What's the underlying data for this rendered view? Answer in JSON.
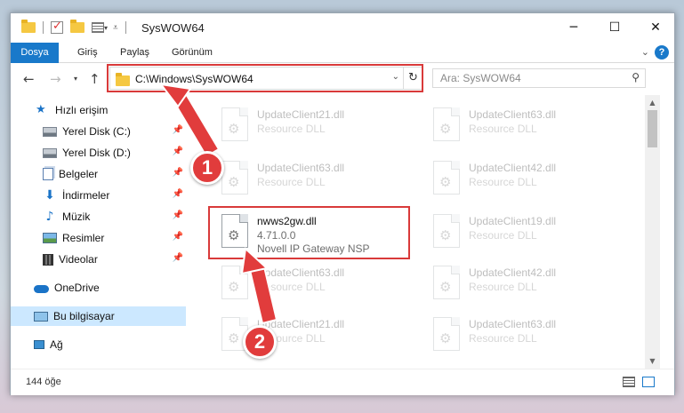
{
  "window": {
    "title": "SysWOW64",
    "controls": {
      "minimize": "─",
      "maximize": "☐",
      "close": "✕"
    }
  },
  "ribbon": {
    "tabs": [
      {
        "label": "Dosya"
      },
      {
        "label": "Giriş"
      },
      {
        "label": "Paylaş"
      },
      {
        "label": "Görünüm"
      }
    ],
    "help": "?"
  },
  "address": {
    "path": "C:\\Windows\\SysWOW64",
    "refresh": "↻"
  },
  "search": {
    "placeholder": "Ara: SysWOW64"
  },
  "sidebar": {
    "items": [
      {
        "label": "Hızlı erişim",
        "icon": "star-icon"
      },
      {
        "label": "Yerel Disk (C:)",
        "icon": "drive-icon",
        "pinned": true
      },
      {
        "label": "Yerel Disk (D:)",
        "icon": "drive-icon",
        "pinned": true
      },
      {
        "label": "Belgeler",
        "icon": "documents-icon",
        "pinned": true
      },
      {
        "label": "İndirmeler",
        "icon": "downloads-icon",
        "pinned": true
      },
      {
        "label": "Müzik",
        "icon": "music-icon",
        "pinned": true
      },
      {
        "label": "Resimler",
        "icon": "pictures-icon",
        "pinned": true
      },
      {
        "label": "Videolar",
        "icon": "videos-icon",
        "pinned": true
      },
      {
        "label": "OneDrive",
        "icon": "cloud-icon"
      },
      {
        "label": "Bu bilgisayar",
        "icon": "computer-icon",
        "selected": true
      },
      {
        "label": "Ağ",
        "icon": "network-icon"
      }
    ]
  },
  "files": {
    "highlighted": {
      "name": "nwws2gw.dll",
      "version": "4.71.0.0",
      "description": "Novell IP Gateway NSP"
    },
    "background": [
      {
        "name": "UpdateClient21.dll",
        "type": "Resource DLL"
      },
      {
        "name": "UpdateClient63.dll",
        "type": "Resource DLL"
      },
      {
        "name": "UpdateClient63.dll",
        "type": "Resource DLL"
      },
      {
        "name": "UpdateClient42.dll",
        "type": "Resource DLL"
      },
      {
        "name": "UpdateClient19.dll",
        "type": "Resource DLL"
      },
      {
        "name": "UpdateClient63.dll",
        "type": "Resource DLL"
      },
      {
        "name": "UpdateClient42.dll",
        "type": "Resource DLL"
      },
      {
        "name": "UpdateClient21.dll",
        "type": "Resource DLL"
      },
      {
        "name": "UpdateClient63.dll",
        "type": "Resource DLL"
      }
    ]
  },
  "status": {
    "count": "144 öğe"
  },
  "callouts": [
    {
      "number": "1"
    },
    {
      "number": "2"
    }
  ],
  "colors": {
    "accent": "#1979ca",
    "annotation": "#e13c3c",
    "selection": "#cce8ff"
  }
}
